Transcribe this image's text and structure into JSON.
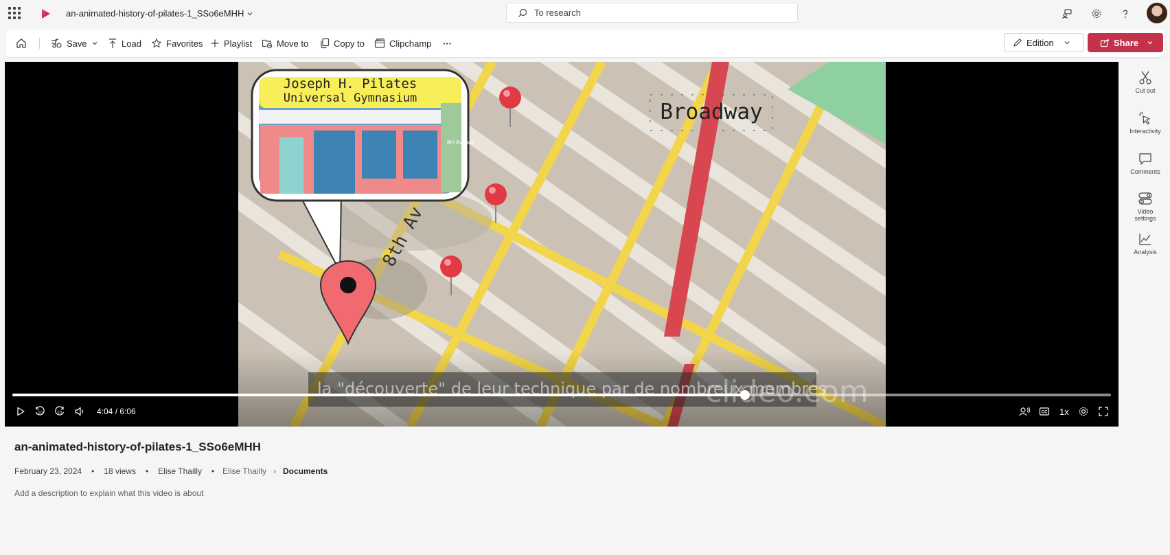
{
  "header": {
    "file_title": "an-animated-history-of-pilates-1_SSo6eMHH",
    "search_placeholder": "To research",
    "icons": [
      "app-launcher-icon",
      "stream-logo-icon",
      "chevron-down-icon",
      "search-icon",
      "share-screen-icon",
      "gear-icon",
      "help-icon"
    ]
  },
  "toolbar": {
    "save": "Save",
    "load": "Load",
    "favorites": "Favorites",
    "playlist": "Playlist",
    "move_to": "Move to",
    "copy_to": "Copy to",
    "clipchamp": "Clipchamp",
    "more": "···",
    "edition": "Edition",
    "share": "Share",
    "accent_color": "#c4314b"
  },
  "video": {
    "caption": "la \"découverte\" de leur technique par de nombreux membres",
    "watermark": "clideo.com",
    "scene_labels": {
      "sign_line1": "Joseph H. Pilates",
      "sign_line2": "Universal Gymnasium",
      "street": "8th Av",
      "broadway": "Broadway",
      "avenue_sign": "8th Avenue"
    },
    "time": "4:04 / 6:06",
    "progress_fraction": 0.667,
    "speed": "1x"
  },
  "rail": {
    "cut_out": "Cut out",
    "interactivity": "Interactivity",
    "comments": "Comments",
    "video_settings_1": "Video",
    "video_settings_2": "settings",
    "analysis": "Analysis"
  },
  "info": {
    "title": "an-animated-history-of-pilates-1_SSo6eMHH",
    "date": "February 23, 2024",
    "views": "18 views",
    "author": "Elise Thailly",
    "owner": "Elise Thailly",
    "folder": "Documents",
    "description_placeholder": "Add a description to explain what this video is about",
    "bullet": "•",
    "crumb_chevron": "›"
  }
}
